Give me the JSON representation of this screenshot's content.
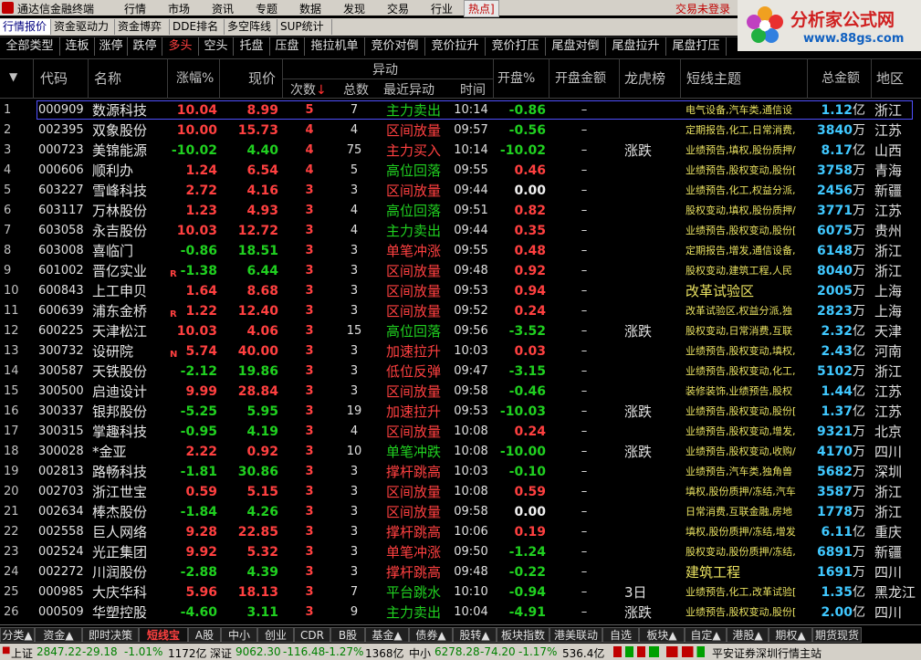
{
  "menubar": {
    "app_title": "通达信金融终端",
    "items": [
      "行情",
      "市场",
      "资讯",
      "专题",
      "数据",
      "发现",
      "交易",
      "行业",
      "热点]"
    ],
    "login": "交易未登录"
  },
  "brand": {
    "name": "分析家公式网",
    "url": "www.88gs.com"
  },
  "tabs1": [
    "行情报价",
    "资金驱动力",
    "资金博弈",
    "DDE排名",
    "多空阵线",
    "SUP统计"
  ],
  "tabs2": [
    "全部类型",
    "连板",
    "涨停",
    "跌停",
    "多头",
    "空头",
    "托盘",
    "压盘",
    "拖拉机单",
    "竞价对倒",
    "竞价拉升",
    "竞价打压",
    "尾盘对倒",
    "尾盘拉升",
    "尾盘打压"
  ],
  "header": {
    "code": "代码",
    "name": "名称",
    "chg": "涨幅%",
    "price": "现价",
    "yidong": "异动",
    "times": "次数",
    "sort": "↓",
    "total": "总数",
    "recent": "最近异动",
    "time": "时间",
    "open": "开盘%",
    "amount": "开盘金额",
    "lhb": "龙虎榜",
    "theme": "短线主题",
    "tot": "总金额",
    "area": "地区"
  },
  "rows": [
    {
      "i": "1",
      "code": "000909",
      "name": "数源科技",
      "flag": "",
      "chg": "10.04",
      "price": "8.99",
      "times": "5",
      "total": "7",
      "recent": "主力卖出",
      "rc": "green",
      "time": "10:14",
      "open": "-0.86",
      "amt": "–",
      "lhb": "",
      "theme": "电气设备,汽车类,通信设",
      "tv": "1.12",
      "tu": "亿",
      "area": "浙江"
    },
    {
      "i": "2",
      "code": "002395",
      "name": "双象股份",
      "flag": "",
      "chg": "10.00",
      "price": "15.73",
      "times": "4",
      "total": "4",
      "recent": "区间放量",
      "rc": "red",
      "time": "09:57",
      "open": "-0.56",
      "amt": "–",
      "lhb": "",
      "theme": "定期报告,化工,日常消费,",
      "tv": "3840",
      "tu": "万",
      "area": "江苏"
    },
    {
      "i": "3",
      "code": "000723",
      "name": "美锦能源",
      "flag": "",
      "chg": "-10.02",
      "price": "4.40",
      "times": "4",
      "total": "75",
      "recent": "主力买入",
      "rc": "red",
      "time": "10:14",
      "open": "-10.02",
      "amt": "–",
      "lhb": "涨跌",
      "theme": "业绩预告,填权,股份质押/",
      "tv": "8.17",
      "tu": "亿",
      "area": "山西"
    },
    {
      "i": "4",
      "code": "000606",
      "name": "顺利办",
      "flag": "",
      "chg": "1.24",
      "price": "6.54",
      "times": "4",
      "total": "5",
      "recent": "高位回落",
      "rc": "green",
      "time": "09:55",
      "open": "0.46",
      "amt": "–",
      "lhb": "",
      "theme": "业绩预告,股权变动,股份[",
      "tv": "3758",
      "tu": "万",
      "area": "青海"
    },
    {
      "i": "5",
      "code": "603227",
      "name": "雪峰科技",
      "flag": "",
      "chg": "2.72",
      "price": "4.16",
      "times": "3",
      "total": "3",
      "recent": "区间放量",
      "rc": "red",
      "time": "09:44",
      "open": "0.00",
      "amt": "–",
      "lhb": "",
      "theme": "业绩预告,化工,权益分派,",
      "tv": "2456",
      "tu": "万",
      "area": "新疆"
    },
    {
      "i": "6",
      "code": "603117",
      "name": "万林股份",
      "flag": "",
      "chg": "1.23",
      "price": "4.93",
      "times": "3",
      "total": "4",
      "recent": "高位回落",
      "rc": "green",
      "time": "09:51",
      "open": "0.82",
      "amt": "–",
      "lhb": "",
      "theme": "股权变动,填权,股份质押/",
      "tv": "3771",
      "tu": "万",
      "area": "江苏"
    },
    {
      "i": "7",
      "code": "603058",
      "name": "永吉股份",
      "flag": "",
      "chg": "10.03",
      "price": "12.72",
      "times": "3",
      "total": "4",
      "recent": "主力卖出",
      "rc": "green",
      "time": "09:44",
      "open": "0.35",
      "amt": "–",
      "lhb": "",
      "theme": "业绩预告,股权变动,股份[",
      "tv": "6075",
      "tu": "万",
      "area": "贵州"
    },
    {
      "i": "8",
      "code": "603008",
      "name": "喜临门",
      "flag": "",
      "chg": "-0.86",
      "price": "18.51",
      "times": "3",
      "total": "3",
      "recent": "单笔冲涨",
      "rc": "red",
      "time": "09:55",
      "open": "0.48",
      "amt": "–",
      "lhb": "",
      "theme": "定期报告,增发,通信设备,",
      "tv": "6148",
      "tu": "万",
      "area": "浙江"
    },
    {
      "i": "9",
      "code": "601002",
      "name": "晋亿实业",
      "flag": "R",
      "chg": "-1.38",
      "price": "6.44",
      "times": "3",
      "total": "3",
      "recent": "区间放量",
      "rc": "red",
      "time": "09:48",
      "open": "0.92",
      "amt": "–",
      "lhb": "",
      "theme": "股权变动,建筑工程,人民",
      "tv": "8040",
      "tu": "万",
      "area": "浙江"
    },
    {
      "i": "10",
      "code": "600843",
      "name": "上工申贝",
      "flag": "",
      "chg": "1.64",
      "price": "8.68",
      "times": "3",
      "total": "3",
      "recent": "区间放量",
      "rc": "red",
      "time": "09:53",
      "open": "0.94",
      "amt": "–",
      "lhb": "",
      "theme": "改革试验区",
      "big": true,
      "tv": "2005",
      "tu": "万",
      "area": "上海"
    },
    {
      "i": "11",
      "code": "600639",
      "name": "浦东金桥",
      "flag": "R",
      "chg": "1.22",
      "price": "12.40",
      "times": "3",
      "total": "3",
      "recent": "区间放量",
      "rc": "red",
      "time": "09:52",
      "open": "0.24",
      "amt": "–",
      "lhb": "",
      "theme": "改革试验区,权益分派,独",
      "tv": "2823",
      "tu": "万",
      "area": "上海"
    },
    {
      "i": "12",
      "code": "600225",
      "name": "天津松江",
      "flag": "",
      "chg": "10.03",
      "price": "4.06",
      "times": "3",
      "total": "15",
      "recent": "高位回落",
      "rc": "green",
      "time": "09:56",
      "open": "-3.52",
      "amt": "–",
      "lhb": "涨跌",
      "theme": "股权变动,日常消费,互联",
      "tv": "2.32",
      "tu": "亿",
      "area": "天津"
    },
    {
      "i": "13",
      "code": "300732",
      "name": "设研院",
      "flag": "N",
      "chg": "5.74",
      "price": "40.00",
      "times": "3",
      "total": "3",
      "recent": "加速拉升",
      "rc": "red",
      "time": "10:03",
      "open": "0.03",
      "amt": "–",
      "lhb": "",
      "theme": "业绩预告,股权变动,填权,",
      "tv": "2.43",
      "tu": "亿",
      "area": "河南"
    },
    {
      "i": "14",
      "code": "300587",
      "name": "天铁股份",
      "flag": "",
      "chg": "-2.12",
      "price": "19.86",
      "times": "3",
      "total": "3",
      "recent": "低位反弹",
      "rc": "red",
      "time": "09:47",
      "open": "-3.15",
      "amt": "–",
      "lhb": "",
      "theme": "业绩预告,股权变动,化工,",
      "tv": "5102",
      "tu": "万",
      "area": "浙江"
    },
    {
      "i": "15",
      "code": "300500",
      "name": "启迪设计",
      "flag": "",
      "chg": "9.99",
      "price": "28.84",
      "times": "3",
      "total": "3",
      "recent": "区间放量",
      "rc": "red",
      "time": "09:58",
      "open": "-0.46",
      "amt": "–",
      "lhb": "",
      "theme": "装修装饰,业绩预告,股权",
      "tv": "1.44",
      "tu": "亿",
      "area": "江苏"
    },
    {
      "i": "16",
      "code": "300337",
      "name": "银邦股份",
      "flag": "",
      "chg": "-5.25",
      "price": "5.95",
      "times": "3",
      "total": "19",
      "recent": "加速拉升",
      "rc": "red",
      "time": "09:53",
      "open": "-10.03",
      "amt": "–",
      "lhb": "涨跌",
      "theme": "业绩预告,股权变动,股份[",
      "tv": "1.37",
      "tu": "亿",
      "area": "江苏"
    },
    {
      "i": "17",
      "code": "300315",
      "name": "掌趣科技",
      "flag": "",
      "chg": "-0.95",
      "price": "4.19",
      "times": "3",
      "total": "4",
      "recent": "区间放量",
      "rc": "red",
      "time": "10:08",
      "open": "0.24",
      "amt": "–",
      "lhb": "",
      "theme": "业绩预告,股权变动,增发,",
      "tv": "9321",
      "tu": "万",
      "area": "北京"
    },
    {
      "i": "18",
      "code": "300028",
      "name": "*金亚",
      "flag": "",
      "chg": "2.22",
      "price": "0.92",
      "times": "3",
      "total": "10",
      "recent": "单笔冲跌",
      "rc": "green",
      "time": "10:08",
      "open": "-10.00",
      "amt": "–",
      "lhb": "涨跌",
      "theme": "业绩预告,股权变动,收购/",
      "tv": "4170",
      "tu": "万",
      "area": "四川"
    },
    {
      "i": "19",
      "code": "002813",
      "name": "路畅科技",
      "flag": "",
      "chg": "-1.81",
      "price": "30.86",
      "times": "3",
      "total": "3",
      "recent": "撑杆跳高",
      "rc": "red",
      "time": "10:03",
      "open": "-0.10",
      "amt": "–",
      "lhb": "",
      "theme": "业绩预告,汽车类,独角兽",
      "tv": "5682",
      "tu": "万",
      "area": "深圳"
    },
    {
      "i": "20",
      "code": "002703",
      "name": "浙江世宝",
      "flag": "",
      "chg": "0.59",
      "price": "5.15",
      "times": "3",
      "total": "3",
      "recent": "区间放量",
      "rc": "red",
      "time": "10:08",
      "open": "0.59",
      "amt": "–",
      "lhb": "",
      "theme": "填权,股份质押/冻结,汽车",
      "tv": "3587",
      "tu": "万",
      "area": "浙江"
    },
    {
      "i": "21",
      "code": "002634",
      "name": "棒杰股份",
      "flag": "",
      "chg": "-1.84",
      "price": "4.26",
      "times": "3",
      "total": "3",
      "recent": "区间放量",
      "rc": "red",
      "time": "09:58",
      "open": "0.00",
      "amt": "–",
      "lhb": "",
      "theme": "日常消费,互联金融,房地",
      "tv": "1778",
      "tu": "万",
      "area": "浙江"
    },
    {
      "i": "22",
      "code": "002558",
      "name": "巨人网络",
      "flag": "",
      "chg": "9.28",
      "price": "22.85",
      "times": "3",
      "total": "3",
      "recent": "撑杆跳高",
      "rc": "red",
      "time": "10:06",
      "open": "0.19",
      "amt": "–",
      "lhb": "",
      "theme": "填权,股份质押/冻结,增发",
      "tv": "6.11",
      "tu": "亿",
      "area": "重庆"
    },
    {
      "i": "23",
      "code": "002524",
      "name": "光正集团",
      "flag": "",
      "chg": "9.92",
      "price": "5.32",
      "times": "3",
      "total": "3",
      "recent": "单笔冲涨",
      "rc": "red",
      "time": "09:50",
      "open": "-1.24",
      "amt": "–",
      "lhb": "",
      "theme": "股权变动,股份质押/冻结,",
      "tv": "6891",
      "tu": "万",
      "area": "新疆"
    },
    {
      "i": "24",
      "code": "002272",
      "name": "川润股份",
      "flag": "",
      "chg": "-2.88",
      "price": "4.39",
      "times": "3",
      "total": "3",
      "recent": "撑杆跳高",
      "rc": "red",
      "time": "09:48",
      "open": "-0.22",
      "amt": "–",
      "lhb": "",
      "theme": "建筑工程",
      "big": true,
      "tv": "1691",
      "tu": "万",
      "area": "四川"
    },
    {
      "i": "25",
      "code": "000985",
      "name": "大庆华科",
      "flag": "",
      "chg": "5.96",
      "price": "18.13",
      "times": "3",
      "total": "7",
      "recent": "平台跳水",
      "rc": "green",
      "time": "10:10",
      "open": "-0.94",
      "amt": "–",
      "lhb": "3日",
      "theme": "业绩预告,化工,改革试验[",
      "tv": "1.35",
      "tu": "亿",
      "area": "黑龙江"
    },
    {
      "i": "26",
      "code": "000509",
      "name": "华塑控股",
      "flag": "",
      "chg": "-4.60",
      "price": "3.11",
      "times": "3",
      "total": "9",
      "recent": "主力卖出",
      "rc": "green",
      "time": "10:04",
      "open": "-4.91",
      "amt": "–",
      "lhb": "涨跌",
      "theme": "业绩预告,股权变动,股份[",
      "tv": "2.00",
      "tu": "亿",
      "area": "四川"
    }
  ],
  "bottom_tabs": [
    "分类▲",
    "资金▲",
    "即时决策",
    "短线宝",
    "A股",
    "中小",
    "创业",
    "CDR",
    "B股",
    "基金▲",
    "债券▲",
    "股转▲",
    "板块指数",
    "港美联动",
    "自选",
    "板块▲",
    "自定▲",
    "港股▲",
    "期权▲",
    "期货现货"
  ],
  "status": {
    "sh_label": "上证",
    "sh_val": "2847.22",
    "sh_chg": "-29.18",
    "sh_pct": "-1.01%",
    "sh_amt": "1172亿",
    "sz_label": "深证",
    "sz_val": "9062.30",
    "sz_chg": "-116.48",
    "sz_pct": "-1.27%",
    "sz_amt": "1368亿",
    "zx_label": "中小",
    "zx_val": "6278.28",
    "zx_chg": "-74.20",
    "zx_pct": "-1.17%",
    "zx_amt": "536.4亿",
    "broker": "平安证券深圳行情主站"
  }
}
